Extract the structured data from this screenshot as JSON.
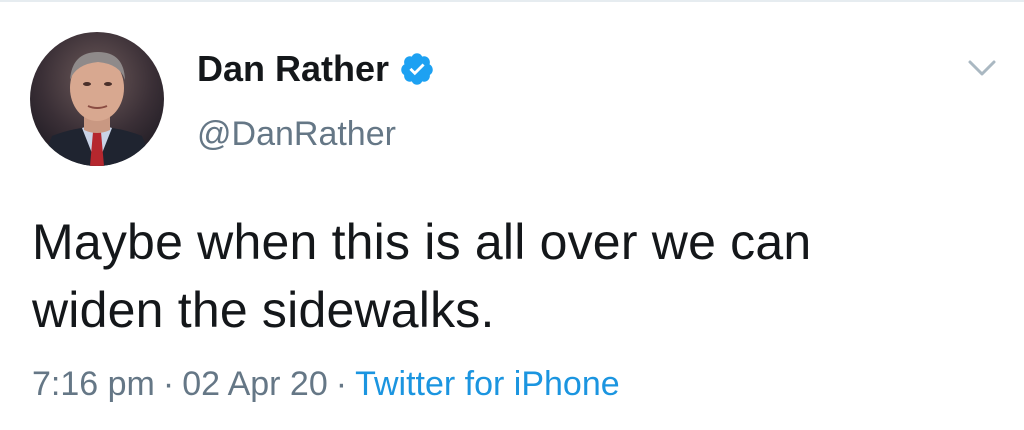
{
  "author": {
    "display_name": "Dan Rather",
    "handle": "@DanRather",
    "verified": true
  },
  "tweet": {
    "text_line1": "Maybe when this is all over we can",
    "text_line2": "widen the sidewalks."
  },
  "meta": {
    "time": "7:16 pm",
    "separator": "·",
    "date": "02 Apr 20",
    "source": "Twitter for iPhone"
  },
  "icons": {
    "verified": "verified-badge-icon",
    "menu": "chevron-down-icon"
  },
  "colors": {
    "text": "#14171a",
    "secondary": "#657786",
    "link": "#1b95e0",
    "verified": "#1da1f2"
  }
}
